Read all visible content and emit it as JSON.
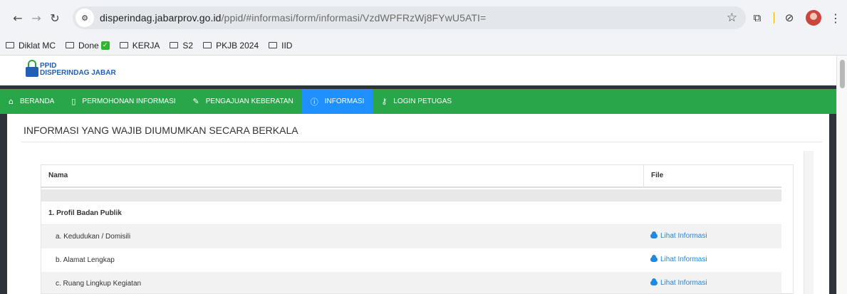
{
  "browser": {
    "url_domain": "disperindag.jabarprov.go.id",
    "url_path": "/ppid/#informasi/form/informasi/VzdWPFRzWj8FYwU5ATI="
  },
  "bookmarks": [
    {
      "label": "Diklat MC"
    },
    {
      "label": "Done",
      "badge": "✓"
    },
    {
      "label": "KERJA"
    },
    {
      "label": "S2"
    },
    {
      "label": "PKJB 2024"
    },
    {
      "label": "IID"
    }
  ],
  "site": {
    "logo_line1": "PPID",
    "logo_line2": "DISPERINDAG JABAR",
    "nav": [
      {
        "icon": "⌂",
        "label": "BERANDA"
      },
      {
        "icon": "▯",
        "label": "PERMOHONAN INFORMASI"
      },
      {
        "icon": "✎",
        "label": "PENGAJUAN KEBERATAN"
      },
      {
        "icon": "ⓘ",
        "label": "INFORMASI"
      },
      {
        "icon": "⚷",
        "label": "LOGIN PETUGAS"
      }
    ],
    "active_nav": "INFORMASI",
    "page_title": "INFORMASI YANG WAJIB DIUMUMKAN SECARA BERKALA",
    "table": {
      "headers": {
        "nama": "Nama",
        "file": "File"
      },
      "section": "1. Profil Badan Publik",
      "rows": [
        {
          "nama": "a. Kedudukan / Domisili",
          "file": "Lihat Informasi"
        },
        {
          "nama": "b. Alamat Lengkap",
          "file": "Lihat Informasi"
        },
        {
          "nama": "c. Ruang Lingkup Kegiatan",
          "file": "Lihat Informasi"
        }
      ]
    }
  },
  "colors": {
    "nav_green": "#2aa64a",
    "nav_active": "#1e90ff",
    "link_blue": "#1e88e5"
  }
}
